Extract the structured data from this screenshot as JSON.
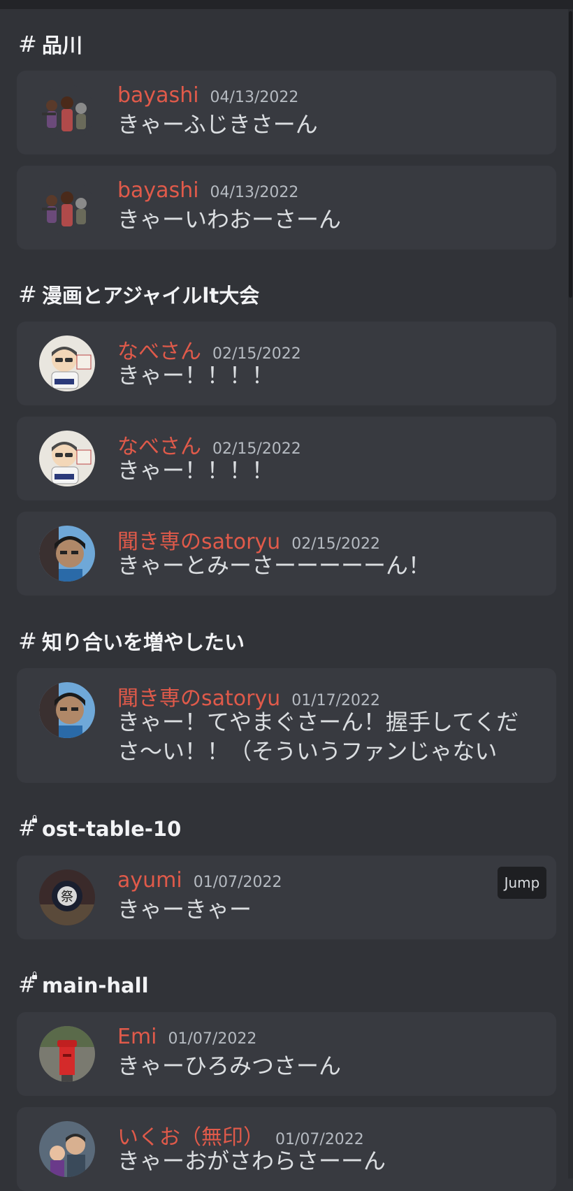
{
  "groups": [
    {
      "channel": "品川",
      "messages": [
        {
          "author": "bayashi",
          "date": "04/13/2022",
          "text": "きゃーふじきさーん"
        },
        {
          "author": "bayashi",
          "date": "04/13/2022",
          "text": "きゃーいわおーさーん"
        }
      ]
    },
    {
      "channel": "漫画とアジャイルlt大会",
      "messages": [
        {
          "author": "なべさん",
          "date": "02/15/2022",
          "text": "きゃー！！！！"
        },
        {
          "author": "なべさん",
          "date": "02/15/2022",
          "text": "きゃー！！！！"
        },
        {
          "author": "聞き専のsatoryu",
          "date": "02/15/2022",
          "text": "きゃーとみーさーーーーーん！"
        }
      ]
    },
    {
      "channel": "知り合いを増やしたい",
      "messages": [
        {
          "author": "聞き専のsatoryu",
          "date": "01/17/2022",
          "text_line1": "きゃー！てやまぐさーん！握手してくだ",
          "text_line2": "さ～い！！（そういうファンじゃない"
        }
      ]
    },
    {
      "channel": "ost-table-10",
      "channel_locked": true,
      "messages": [
        {
          "author": "ayumi",
          "date": "01/07/2022",
          "text": "きゃーきゃー",
          "jump_label": "Jump"
        }
      ]
    },
    {
      "channel": "main-hall",
      "channel_locked": true,
      "messages": [
        {
          "author": "Emi",
          "date": "01/07/2022",
          "text": "きゃーひろみつさーん"
        },
        {
          "author": "いくお（無印）",
          "date": "01/07/2022",
          "text": "きゃーおがさわらさーーん"
        }
      ]
    }
  ],
  "icons": {
    "channel": "hash-icon",
    "locked_channel": "hash-lock-icon"
  },
  "colors": {
    "background": "#313338",
    "card": "#383a40",
    "author": "#e05a4a",
    "timestamp": "#b5bac1",
    "text": "#dbdee1"
  }
}
